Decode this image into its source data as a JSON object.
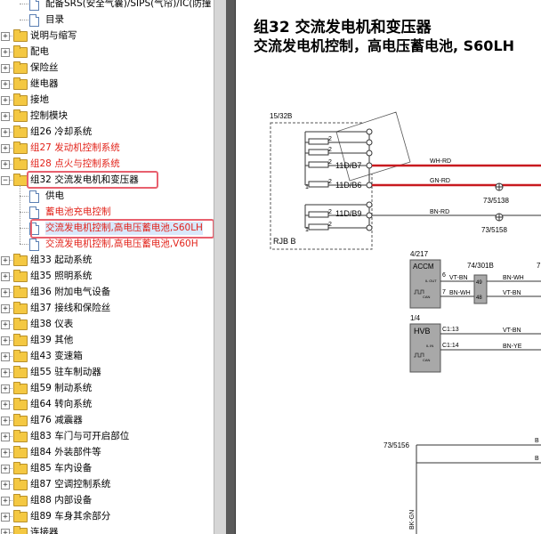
{
  "tree": {
    "items": [
      {
        "label": "配备SRS(安全气囊)/SIPS(气帘)/IC(防撞",
        "type": "doc",
        "level": 1,
        "toggle": "",
        "color": "normal"
      },
      {
        "label": "目录",
        "type": "doc",
        "level": 1,
        "toggle": "",
        "color": "normal"
      },
      {
        "label": "说明与缩写",
        "type": "folder",
        "level": 0,
        "toggle": "+",
        "color": "normal"
      },
      {
        "label": "配电",
        "type": "folder",
        "level": 0,
        "toggle": "+",
        "color": "normal"
      },
      {
        "label": "保险丝",
        "type": "folder",
        "level": 0,
        "toggle": "+",
        "color": "normal"
      },
      {
        "label": "继电器",
        "type": "folder",
        "level": 0,
        "toggle": "+",
        "color": "normal"
      },
      {
        "label": "接地",
        "type": "folder",
        "level": 0,
        "toggle": "+",
        "color": "normal"
      },
      {
        "label": "控制模块",
        "type": "folder",
        "level": 0,
        "toggle": "+",
        "color": "normal"
      },
      {
        "label": "组26 冷却系统",
        "type": "folder",
        "level": 0,
        "toggle": "+",
        "color": "normal"
      },
      {
        "label": "组27 发动机控制系统",
        "type": "folder",
        "level": 0,
        "toggle": "+",
        "color": "red"
      },
      {
        "label": "组28 点火与控制系统",
        "type": "folder",
        "level": 0,
        "toggle": "+",
        "color": "red"
      },
      {
        "label": "组32 交流发电机和变压器",
        "type": "folder",
        "level": 0,
        "toggle": "−",
        "color": "normal"
      },
      {
        "label": "供电",
        "type": "doc",
        "level": 1,
        "toggle": "",
        "color": "normal"
      },
      {
        "label": "蓄电池充电控制",
        "type": "doc",
        "level": 1,
        "toggle": "",
        "color": "red"
      },
      {
        "label": "交流发电机控制,高电压蓄电池,S60LH",
        "type": "doc",
        "level": 1,
        "toggle": "",
        "color": "selected"
      },
      {
        "label": "交流发电机控制,高电压蓄电池,V60H",
        "type": "doc",
        "level": 1,
        "toggle": "",
        "color": "red"
      },
      {
        "label": "组33 起动系统",
        "type": "folder",
        "level": 0,
        "toggle": "+",
        "color": "normal"
      },
      {
        "label": "组35 照明系统",
        "type": "folder",
        "level": 0,
        "toggle": "+",
        "color": "normal"
      },
      {
        "label": "组36 附加电气设备",
        "type": "folder",
        "level": 0,
        "toggle": "+",
        "color": "normal"
      },
      {
        "label": "组37 接线和保险丝",
        "type": "folder",
        "level": 0,
        "toggle": "+",
        "color": "normal"
      },
      {
        "label": "组38 仪表",
        "type": "folder",
        "level": 0,
        "toggle": "+",
        "color": "normal"
      },
      {
        "label": "组39 其他",
        "type": "folder",
        "level": 0,
        "toggle": "+",
        "color": "normal"
      },
      {
        "label": "组43 变速箱",
        "type": "folder",
        "level": 0,
        "toggle": "+",
        "color": "normal"
      },
      {
        "label": "组55 驻车制动器",
        "type": "folder",
        "level": 0,
        "toggle": "+",
        "color": "normal"
      },
      {
        "label": "组59 制动系统",
        "type": "folder",
        "level": 0,
        "toggle": "+",
        "color": "normal"
      },
      {
        "label": "组64 转向系统",
        "type": "folder",
        "level": 0,
        "toggle": "+",
        "color": "normal"
      },
      {
        "label": "组76 减震器",
        "type": "folder",
        "level": 0,
        "toggle": "+",
        "color": "normal"
      },
      {
        "label": "组83 车门与可开启部位",
        "type": "folder",
        "level": 0,
        "toggle": "+",
        "color": "normal"
      },
      {
        "label": "组84 外装部件等",
        "type": "folder",
        "level": 0,
        "toggle": "+",
        "color": "normal"
      },
      {
        "label": "组85 车内设备",
        "type": "folder",
        "level": 0,
        "toggle": "+",
        "color": "normal"
      },
      {
        "label": "组87 空调控制系统",
        "type": "folder",
        "level": 0,
        "toggle": "+",
        "color": "normal"
      },
      {
        "label": "组88 内部设备",
        "type": "folder",
        "level": 0,
        "toggle": "+",
        "color": "normal"
      },
      {
        "label": "组89 车身其余部分",
        "type": "folder",
        "level": 0,
        "toggle": "+",
        "color": "normal"
      },
      {
        "label": "连接器",
        "type": "folder",
        "level": 0,
        "toggle": "+",
        "color": "normal"
      }
    ]
  },
  "document": {
    "title_line1": "组32 交流发电机和变压器",
    "title_line2": "交流发电机控制，高电压蓄电池, S60LH"
  },
  "diagram": {
    "labels": {
      "rjb_ref": "15/32B",
      "rjb_name": "RJB B",
      "pin2": "2",
      "pin1": "1",
      "conn_b7": "11D/B7",
      "conn_b6": "11D/B6",
      "conn_b9": "11D/B9",
      "wire_wh_rd": "WH-RD",
      "wire_gn_rd": "GN-RD",
      "wire_bn_rd": "BN-RD",
      "splice_5138": "73/5138",
      "splice_5158": "73/5158",
      "accm_ref": "4/217",
      "accm_name": "ACCM",
      "il_out": "IL OUT",
      "can": "CAN",
      "pin6": "6",
      "pin7": "7",
      "wire_vt_bn_a": "VT-BN",
      "wire_bn_wh": "BN-WH",
      "conn_301b": "74/301B",
      "conn_301b_right": "7",
      "pin49": "49",
      "pin48": "48",
      "wire_bn_wh_r": "BN-WH",
      "wire_vt_bn_r": "VT-BN",
      "hvb_ref": "1/4",
      "hvb_name": "HVB",
      "il_in": "IL IN",
      "c1_13": "C1:13",
      "c1_14": "C1:14",
      "wire_vt_bn_h": "VT-BN",
      "wire_bn_ye": "BN-YE",
      "splice_5156": "73/5156",
      "bk_gn": "BK-GN",
      "edge_b1": "B",
      "edge_b2": "B"
    }
  },
  "colors": {
    "red_text": "#e2231a",
    "wire_red": "#c8191f",
    "highlight_box": "#e8606e",
    "selection_bg": "#d9e8fb",
    "folder": "#f4c842",
    "module_gray": "#a8a8a8"
  }
}
